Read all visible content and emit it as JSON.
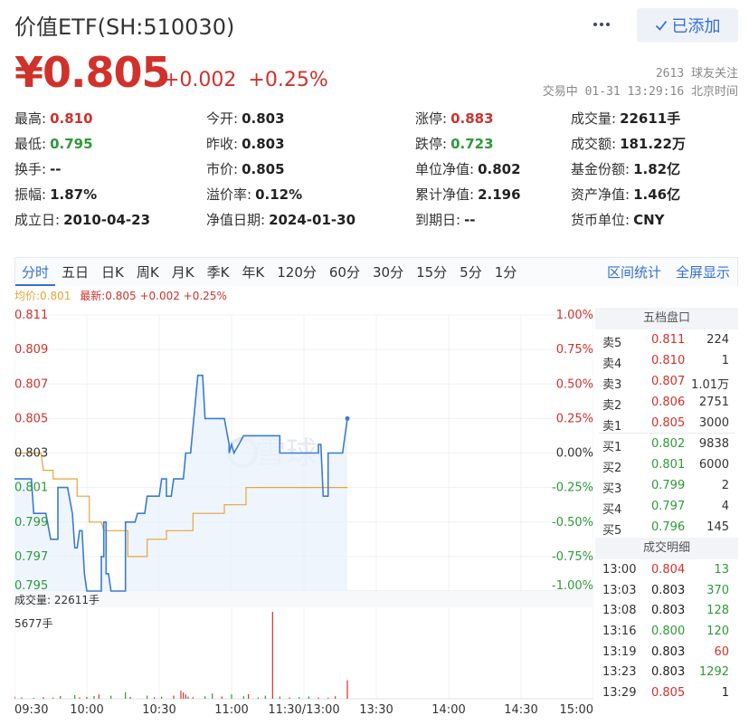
{
  "header": {
    "title": "价值ETF(SH:510030)",
    "follow_label": "已添加",
    "price": "¥0.805",
    "change": "+0.002",
    "change_pct": "+0.25%",
    "followers": "2613 球友关注",
    "trade_status": "交易中 01-31 13:29:16 北京时间"
  },
  "quote": [
    [
      {
        "label": "最高:",
        "value": "0.810",
        "color": "red"
      },
      {
        "label": "今开:",
        "value": "0.803",
        "color": "dark"
      },
      {
        "label": "涨停:",
        "value": "0.883",
        "color": "red"
      },
      {
        "label": "成交量:",
        "value": "22611手",
        "color": "dark"
      }
    ],
    [
      {
        "label": "最低:",
        "value": "0.795",
        "color": "green"
      },
      {
        "label": "昨收:",
        "value": "0.803",
        "color": "dark"
      },
      {
        "label": "跌停:",
        "value": "0.723",
        "color": "green"
      },
      {
        "label": "成交额:",
        "value": "181.22万",
        "color": "dark"
      }
    ],
    [
      {
        "label": "换手:",
        "value": "--",
        "color": "dark"
      },
      {
        "label": "市价:",
        "value": "0.805",
        "color": "dark"
      },
      {
        "label": "单位净值:",
        "value": "0.802",
        "color": "dark"
      },
      {
        "label": "基金份额:",
        "value": "1.82亿",
        "color": "dark"
      }
    ],
    [
      {
        "label": "振幅:",
        "value": "1.87%",
        "color": "dark"
      },
      {
        "label": "溢价率:",
        "value": "0.12%",
        "color": "dark"
      },
      {
        "label": "累计净值:",
        "value": "2.196",
        "color": "dark"
      },
      {
        "label": "资产净值:",
        "value": "1.46亿",
        "color": "dark"
      }
    ],
    [
      {
        "label": "成立日:",
        "value": "2010-04-23",
        "color": "dark"
      },
      {
        "label": "净值日期:",
        "value": "2024-01-30",
        "color": "dark"
      },
      {
        "label": "到期日:",
        "value": "--",
        "color": "dark"
      },
      {
        "label": "货币单位:",
        "value": "CNY",
        "color": "dark"
      }
    ]
  ],
  "tabs": [
    "分时",
    "五日",
    "日K",
    "周K",
    "月K",
    "季K",
    "年K",
    "120分",
    "60分",
    "30分",
    "15分",
    "5分",
    "1分"
  ],
  "active_tab": 0,
  "tab_links": [
    "区间统计",
    "全屏显示"
  ],
  "summary": {
    "avg": "均价:0.801",
    "latest": "最新:0.805 +0.002 +0.25%"
  },
  "order_book": {
    "title": "五档盘口",
    "asks": [
      {
        "label": "卖5",
        "price": "0.811",
        "vol": "224",
        "color": "red"
      },
      {
        "label": "卖4",
        "price": "0.810",
        "vol": "1",
        "color": "red"
      },
      {
        "label": "卖3",
        "price": "0.807",
        "vol": "1.01万",
        "color": "red"
      },
      {
        "label": "卖2",
        "price": "0.806",
        "vol": "2751",
        "color": "red"
      },
      {
        "label": "卖1",
        "price": "0.805",
        "vol": "3000",
        "color": "red"
      }
    ],
    "bids": [
      {
        "label": "买1",
        "price": "0.802",
        "vol": "9838",
        "color": "green"
      },
      {
        "label": "买2",
        "price": "0.801",
        "vol": "6000",
        "color": "green"
      },
      {
        "label": "买3",
        "price": "0.799",
        "vol": "2",
        "color": "green"
      },
      {
        "label": "买4",
        "price": "0.797",
        "vol": "4",
        "color": "green"
      },
      {
        "label": "买5",
        "price": "0.796",
        "vol": "145",
        "color": "green"
      }
    ]
  },
  "trade_detail": {
    "title": "成交明细",
    "rows": [
      {
        "time": "13:00",
        "price": "0.804",
        "vol": "13",
        "pcolor": "red",
        "vcolor": "green"
      },
      {
        "time": "13:03",
        "price": "0.803",
        "vol": "370",
        "pcolor": "dark",
        "vcolor": "green"
      },
      {
        "time": "13:08",
        "price": "0.803",
        "vol": "128",
        "pcolor": "dark",
        "vcolor": "green"
      },
      {
        "time": "13:16",
        "price": "0.800",
        "vol": "120",
        "pcolor": "green",
        "vcolor": "green"
      },
      {
        "time": "13:19",
        "price": "0.803",
        "vol": "60",
        "pcolor": "dark",
        "vcolor": "red"
      },
      {
        "time": "13:23",
        "price": "0.803",
        "vol": "1292",
        "pcolor": "dark",
        "vcolor": "green"
      },
      {
        "time": "13:29",
        "price": "0.805",
        "vol": "1",
        "pcolor": "red",
        "vcolor": "dark"
      }
    ]
  },
  "watermark": "雪球",
  "colors": {
    "up": "#d0322b",
    "down": "#2e9a3a",
    "price_line": "#3a7bd5",
    "avg_line": "#e8a33a",
    "accent": "#3370d6"
  },
  "chart_data": {
    "type": "line",
    "price_left_ticks": [
      "0.811",
      "0.809",
      "0.807",
      "0.805",
      "0.803",
      "0.801",
      "0.799",
      "0.797",
      "0.795"
    ],
    "pct_right_ticks": [
      "1.00%",
      "0.75%",
      "0.50%",
      "0.25%",
      "0.00%",
      "-0.25%",
      "-0.50%",
      "-0.75%",
      "-1.00%"
    ],
    "time_ticks": [
      "09:30",
      "10:00",
      "10:30",
      "11:00",
      "11:30/13:00",
      "13:30",
      "14:00",
      "14:30",
      "15:00"
    ],
    "ylim": [
      0.795,
      0.811
    ],
    "prev_close": 0.803,
    "minutes_total": 240,
    "volume_label": "成交量: 22611手",
    "volume_max_label": "5677手",
    "volume_max": 5677,
    "series": [
      {
        "name": "最新",
        "points": [
          [
            0,
            0.8015
          ],
          [
            7,
            0.8015
          ],
          [
            8,
            0.7995
          ],
          [
            13,
            0.7995
          ],
          [
            15,
            0.798
          ],
          [
            18,
            0.798
          ],
          [
            18,
            0.801
          ],
          [
            22,
            0.801
          ],
          [
            24,
            0.7995
          ],
          [
            25,
            0.7975
          ],
          [
            26,
            0.7975
          ],
          [
            27,
            0.7985
          ],
          [
            28,
            0.7985
          ],
          [
            29,
            0.796
          ],
          [
            30,
            0.795
          ],
          [
            36,
            0.795
          ],
          [
            36,
            0.797
          ],
          [
            37,
            0.797
          ],
          [
            37,
            0.799
          ],
          [
            38,
            0.799
          ],
          [
            38,
            0.796
          ],
          [
            39,
            0.796
          ],
          [
            40,
            0.795
          ],
          [
            46,
            0.795
          ],
          [
            46,
            0.799
          ],
          [
            50,
            0.799
          ],
          [
            51,
            0.7995
          ],
          [
            54,
            0.7995
          ],
          [
            55,
            0.8005
          ],
          [
            60,
            0.8005
          ],
          [
            61,
            0.8015
          ],
          [
            63,
            0.8015
          ],
          [
            63,
            0.8005
          ],
          [
            65,
            0.8005
          ],
          [
            66,
            0.8015
          ],
          [
            70,
            0.8015
          ],
          [
            71,
            0.803
          ],
          [
            73,
            0.803
          ],
          [
            76,
            0.8075
          ],
          [
            78,
            0.8075
          ],
          [
            79,
            0.805
          ],
          [
            87,
            0.805
          ],
          [
            89,
            0.8035
          ],
          [
            89,
            0.803
          ],
          [
            90,
            0.8035
          ],
          [
            91,
            0.803
          ],
          [
            93,
            0.8035
          ],
          [
            95,
            0.804
          ],
          [
            104,
            0.804
          ],
          [
            110,
            0.804
          ],
          [
            110,
            0.803
          ],
          [
            120,
            0.803
          ],
          [
            126,
            0.803
          ],
          [
            126,
            0.8035
          ],
          [
            127,
            0.8035
          ],
          [
            128,
            0.8005
          ],
          [
            130,
            0.8005
          ],
          [
            130,
            0.803
          ],
          [
            135,
            0.803
          ],
          [
            136,
            0.803
          ],
          [
            138,
            0.805
          ]
        ]
      },
      {
        "name": "均价",
        "points": [
          [
            0,
            0.803
          ],
          [
            11,
            0.803
          ],
          [
            12,
            0.802
          ],
          [
            16,
            0.802
          ],
          [
            16,
            0.8015
          ],
          [
            26,
            0.8015
          ],
          [
            26,
            0.8005
          ],
          [
            31,
            0.8005
          ],
          [
            31,
            0.799
          ],
          [
            36,
            0.799
          ],
          [
            37,
            0.7985
          ],
          [
            47,
            0.7985
          ],
          [
            47,
            0.797
          ],
          [
            55,
            0.797
          ],
          [
            55,
            0.798
          ],
          [
            63,
            0.798
          ],
          [
            63,
            0.7985
          ],
          [
            74,
            0.7985
          ],
          [
            74,
            0.7995
          ],
          [
            87,
            0.7995
          ],
          [
            87,
            0.8
          ],
          [
            96,
            0.8
          ],
          [
            96,
            0.801
          ],
          [
            120,
            0.801
          ],
          [
            138,
            0.801
          ]
        ]
      }
    ],
    "volume_bars": [
      [
        0,
        140,
        "red"
      ],
      [
        3,
        90,
        "green"
      ],
      [
        8,
        60,
        "green"
      ],
      [
        12,
        110,
        "red"
      ],
      [
        16,
        80,
        "green"
      ],
      [
        19,
        180,
        "green"
      ],
      [
        25,
        240,
        "green"
      ],
      [
        27,
        90,
        "red"
      ],
      [
        30,
        120,
        "red"
      ],
      [
        33,
        180,
        "green"
      ],
      [
        35,
        280,
        "red"
      ],
      [
        40,
        200,
        "green"
      ],
      [
        46,
        430,
        "green"
      ],
      [
        48,
        120,
        "red"
      ],
      [
        55,
        200,
        "green"
      ],
      [
        58,
        100,
        "red"
      ],
      [
        61,
        140,
        "green"
      ],
      [
        66,
        200,
        "red"
      ],
      [
        69,
        520,
        "red"
      ],
      [
        70,
        410,
        "red"
      ],
      [
        71,
        280,
        "red"
      ],
      [
        72,
        150,
        "green"
      ],
      [
        74,
        100,
        "red"
      ],
      [
        79,
        160,
        "green"
      ],
      [
        82,
        350,
        "green"
      ],
      [
        86,
        150,
        "red"
      ],
      [
        90,
        290,
        "green"
      ],
      [
        95,
        170,
        "green"
      ],
      [
        97,
        300,
        "red"
      ],
      [
        101,
        90,
        "green"
      ],
      [
        104,
        200,
        "green"
      ],
      [
        107,
        5677,
        "red"
      ],
      [
        110,
        150,
        "green"
      ],
      [
        114,
        80,
        "red"
      ],
      [
        118,
        110,
        "green"
      ],
      [
        122,
        150,
        "green"
      ],
      [
        126,
        90,
        "red"
      ],
      [
        130,
        70,
        "red"
      ],
      [
        133,
        160,
        "red"
      ],
      [
        138,
        1200,
        "red"
      ]
    ]
  }
}
